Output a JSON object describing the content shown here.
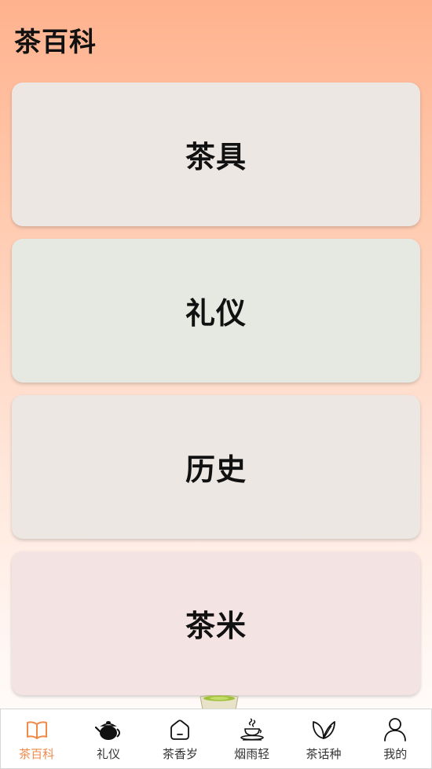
{
  "header": {
    "title": "茶百科"
  },
  "cards": [
    {
      "label": "茶具",
      "color": "#ede7e4"
    },
    {
      "label": "礼仪",
      "color": "#e6e9e1"
    },
    {
      "label": "历史",
      "color": "#ede7e4"
    },
    {
      "label": "茶米",
      "color": "#f4e3e3"
    }
  ],
  "tabbar": {
    "active_color": "#f08a4b",
    "items": [
      {
        "label": "茶百科",
        "icon": "book-icon",
        "active": true
      },
      {
        "label": "礼仪",
        "icon": "teapot-icon",
        "active": false
      },
      {
        "label": "茶香岁",
        "icon": "home-icon",
        "active": false
      },
      {
        "label": "烟雨轻",
        "icon": "steaming-tea-icon",
        "active": false
      },
      {
        "label": "茶话种",
        "icon": "leaf-icon",
        "active": false
      },
      {
        "label": "我的",
        "icon": "user-icon",
        "active": false
      }
    ]
  }
}
